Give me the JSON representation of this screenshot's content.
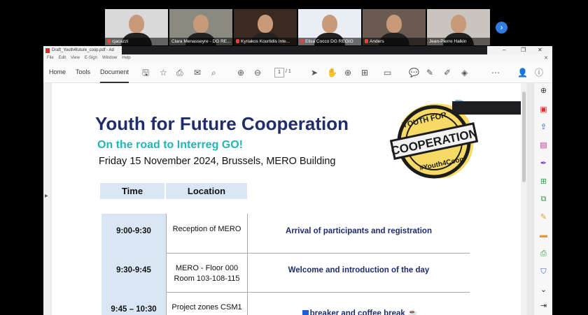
{
  "call": {
    "participants": [
      {
        "name": "cjacazzi",
        "bg": "#d9d9d9",
        "active": false
      },
      {
        "name": "Clara Menasseyre - DG RE...",
        "bg": "#8a8a80",
        "active": true
      },
      {
        "name": "Kyriakos Kourtidis Inte...",
        "bg": "#3a2a22",
        "active": false
      },
      {
        "name": "Elisa Cocco DG REGIO",
        "bg": "#e9eef5",
        "active": false
      },
      {
        "name": "Anders",
        "bg": "#6a5a52",
        "active": false
      },
      {
        "name": "Jean-Pierre Halkin",
        "bg": "#c9c4bd",
        "active": false
      }
    ],
    "next_icon": "chevron-right-icon"
  },
  "window": {
    "title": "Draft_Youth4future_coop.pdf - Ad",
    "menu": [
      "File",
      "Edit",
      "View",
      "E-Sign",
      "Window",
      "Help"
    ],
    "tabs": [
      "Home",
      "Tools",
      "Document"
    ],
    "page_current": "1",
    "page_total": "/ 1"
  },
  "doc": {
    "title": "Youth for Future Cooperation",
    "subtitle": "On the road to Interreg GO!",
    "date": "Friday 15 November 2024, Brussels, MERO Building",
    "stamp": {
      "top": "YOUTH FOR",
      "middle": "COOPERATION",
      "bottom": "#Youth4Coop"
    },
    "table": {
      "headers": [
        "Time",
        "Location"
      ],
      "rows": [
        {
          "time": "9:00-9:30",
          "location": "Reception of MERO",
          "event": "Arrival of participants and registration"
        },
        {
          "time": "9:30-9:45",
          "location": "MERO - Floor 000\nRoom 103-108-115",
          "event": "Welcome and introduction of the day"
        },
        {
          "time": "9:45 – 10:30",
          "location": "Project zones CSM1",
          "event": "breaker and coffee break"
        }
      ]
    }
  },
  "colors": {
    "title": "#1f2d6b",
    "subtitle": "#21b5b5",
    "header_bg": "#dbe6f5",
    "active_tile": "#3fc27f"
  }
}
